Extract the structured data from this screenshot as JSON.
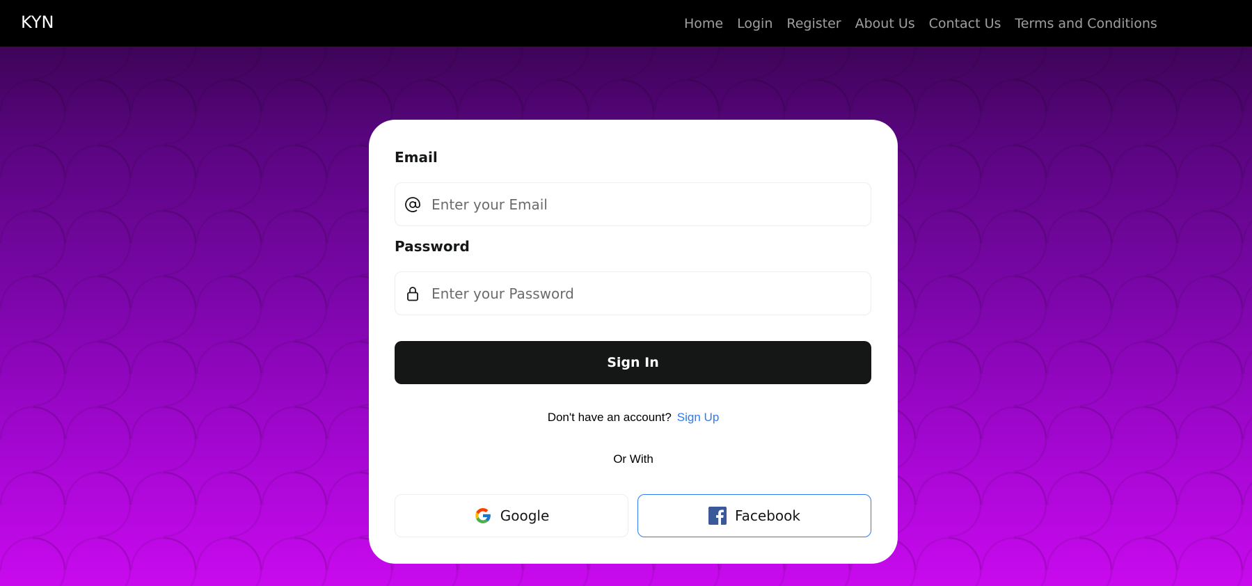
{
  "navbar": {
    "brand": "KYN",
    "links": [
      "Home",
      "Login",
      "Register",
      "About Us",
      "Contact Us",
      "Terms and Conditions"
    ]
  },
  "form": {
    "email_label": "Email",
    "email_placeholder": "Enter your Email",
    "email_icon": "at-icon",
    "password_label": "Password",
    "password_placeholder": "Enter your Password",
    "password_icon": "lock-icon",
    "signin_label": "Sign In",
    "no_account_text": "Don't have an account?",
    "signup_link": "Sign Up",
    "or_with": "Or With",
    "google_label": "Google",
    "facebook_label": "Facebook"
  },
  "colors": {
    "navbar_bg": "#000000",
    "bg_top": "#3e0458",
    "bg_bottom": "#c90aee",
    "button_dark": "#151717",
    "link_blue": "#2d79f3",
    "facebook_blue": "#3b5998"
  }
}
